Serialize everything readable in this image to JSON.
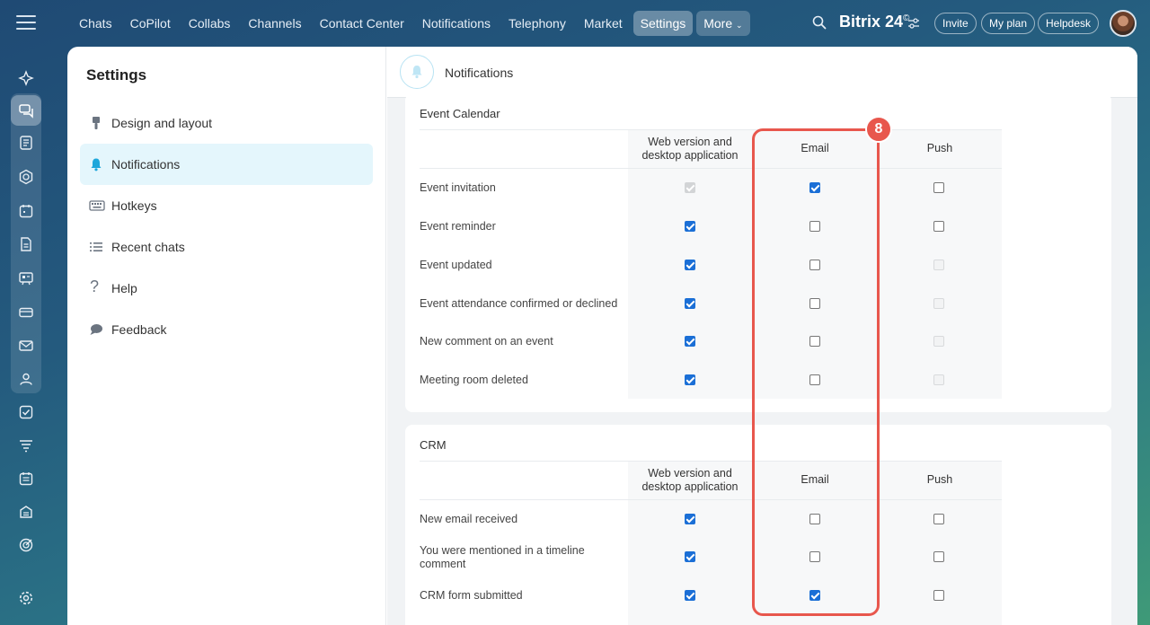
{
  "topnav": {
    "items": [
      "Chats",
      "CoPilot",
      "Collabs",
      "Channels",
      "Contact Center",
      "Notifications",
      "Telephony",
      "Market",
      "Settings",
      "More"
    ],
    "active": "Settings",
    "brand": "Bitrix 24",
    "brand_mark": "©",
    "invite": "Invite",
    "my_plan": "My plan",
    "helpdesk": "Helpdesk"
  },
  "rail_icons": [
    "spark-icon",
    "chat-icon",
    "feed-icon",
    "hexagon-icon",
    "calendar-icon",
    "document-icon",
    "board-icon",
    "card-icon",
    "mail-icon",
    "contacts-icon",
    "tasks-icon",
    "funnel-icon",
    "schedule-icon",
    "store-icon",
    "target-icon",
    "settings-icon"
  ],
  "sidebar": {
    "title": "Settings",
    "items": [
      {
        "label": "Design and layout",
        "icon": "brush-icon"
      },
      {
        "label": "Notifications",
        "icon": "bell-icon",
        "active": true
      },
      {
        "label": "Hotkeys",
        "icon": "keyboard-icon"
      },
      {
        "label": "Recent chats",
        "icon": "list-icon"
      },
      {
        "label": "Help",
        "icon": "question-icon"
      },
      {
        "label": "Feedback",
        "icon": "speech-bubble-icon"
      }
    ]
  },
  "content": {
    "title": "Notifications",
    "columns": [
      "Web version and desktop application",
      "Email",
      "Push"
    ],
    "sections": [
      {
        "title": "Event Calendar",
        "rows": [
          {
            "label": "Event invitation",
            "web": "checked-disabled",
            "email": "checked",
            "push": "unchecked"
          },
          {
            "label": "Event reminder",
            "web": "checked",
            "email": "unchecked",
            "push": "unchecked"
          },
          {
            "label": "Event updated",
            "web": "checked",
            "email": "unchecked",
            "push": "disabled"
          },
          {
            "label": "Event attendance confirmed or declined",
            "web": "checked",
            "email": "unchecked",
            "push": "disabled"
          },
          {
            "label": "New comment on an event",
            "web": "checked",
            "email": "unchecked",
            "push": "disabled"
          },
          {
            "label": "Meeting room deleted",
            "web": "checked",
            "email": "unchecked",
            "push": "disabled"
          }
        ]
      },
      {
        "title": "CRM",
        "rows": [
          {
            "label": "New email received",
            "web": "checked",
            "email": "unchecked",
            "push": "unchecked"
          },
          {
            "label": "You were mentioned in a timeline comment",
            "web": "checked",
            "email": "unchecked",
            "push": "unchecked"
          },
          {
            "label": "CRM form submitted",
            "web": "checked",
            "email": "checked",
            "push": "unchecked"
          }
        ]
      }
    ]
  },
  "annotation": {
    "badge": "8",
    "color": "#e8574d"
  }
}
